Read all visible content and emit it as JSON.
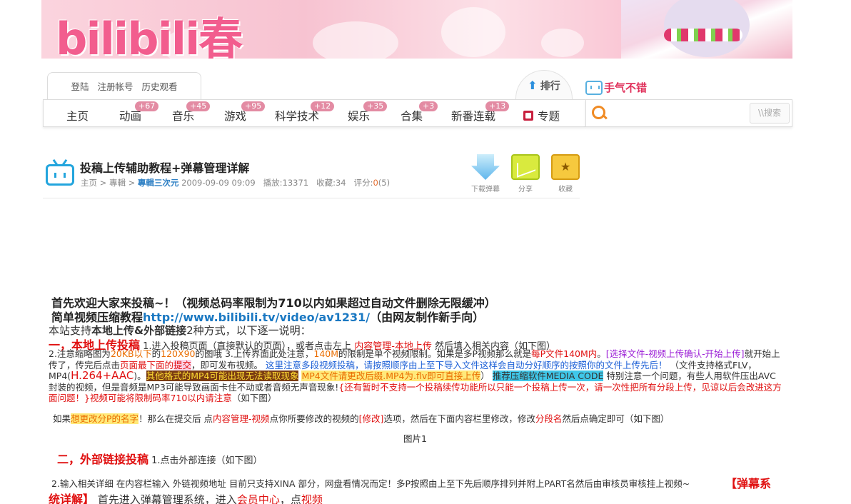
{
  "banner": {
    "logo": "bilibili春"
  },
  "topbar": {
    "login": "登陆",
    "register": "注册帐号",
    "history": "历史观看",
    "rank": "排行",
    "luck": "手气不错"
  },
  "nav": {
    "items": [
      {
        "label": "主页",
        "badge": ""
      },
      {
        "label": "动画",
        "badge": "+67"
      },
      {
        "label": "音乐",
        "badge": "+45"
      },
      {
        "label": "游戏",
        "badge": "+95"
      },
      {
        "label": "科学技术",
        "badge": "+12"
      },
      {
        "label": "娱乐",
        "badge": "+35"
      },
      {
        "label": "合集",
        "badge": "+3"
      },
      {
        "label": "新番连载",
        "badge": "+13"
      },
      {
        "label": "专题",
        "badge": ""
      }
    ]
  },
  "search": {
    "placeholder": "",
    "button": "\\\\搜索"
  },
  "video": {
    "title": "投稿上传辅助教程+弹幕管理详解",
    "crumb_home": "主页",
    "crumb_sep": ">",
    "crumb_section": "專輯",
    "crumb_category": "專輯三次元",
    "datetime": "2009-09-09 09:09",
    "plays_label": "播放:",
    "plays": "13371",
    "favs_label": "收藏:",
    "favs": "34",
    "score_label": "评分:",
    "score": "0",
    "score_count": "(5)",
    "actions": {
      "download": "下载弹幕",
      "share": "分享",
      "fav": "收藏"
    }
  },
  "content": {
    "l1": "首先欢迎大家来投稿~！（视频总码率限制为710以内如果超过自动文件删除无限缓冲）",
    "l2a": "简单视频压缩教程",
    "l2b": "http://www.bilibili.tv/video/av1231/",
    "l2c": "（由网友制作新手向）",
    "l3a": "本站支持",
    "l3b": "本地上传&外部链接",
    "l3c": "2种方式，以下逐一说明：",
    "s1_title": "一，本地上传投稿",
    "s1_a": "1.进入投稿页面（直接默认的页面），或者点击左上",
    "s1_b": "内容管理-本地上传",
    "s1_c": "然后填入相关内容（如下图）",
    "p2_a": "2.注意缩略图为",
    "p2_b": "20KB以下",
    "p2_c": "的",
    "p2_d": "120X90",
    "p2_e": "的图哦 3.上传界面此处注意，",
    "p2_f": "140M",
    "p2_g": "的限制是单个视频限制。如果是多P视频那么就是",
    "p2_h": "每P文件140M内",
    "p2_i": "。",
    "p2_j": "[选择文件-视频上传确认-开始上传]",
    "p2_k": "就开始上传了，传完后点击",
    "p2_l": "页面最下面的",
    "p2_m": "提交",
    "p2_n": "，即可发布视频。",
    "p2_o": "这里注意多段视频投稿，请按照顺序由上至下导入文件这样会自动分好顺序的按照你的文件上传先后！",
    "p2_p": "（文件支持格式FLV，MP4(",
    "p2_q": "H.264+AAC",
    "p2_r": ")。",
    "p2_s": "其他格式的MP4可能出现无法读取现象",
    "p2_t": "MP4文件请更改后缀.MP4为.flv即可直接上传",
    "p2_u": "）",
    "p2_v": "推荐压缩软件MEDIA CODE",
    "p2_w": "特别注意一个问题，有些人用软件压出AVC封装的视频，但是音频是MP3可能导致画面卡住不动或者音频无声音现象!",
    "p2_x": "{还有暂时不支持一个投稿续传功能所以只能一个投稿上传一次，请一次性把所有分段上传，见谅以后会改进这方面问题！}",
    "p2_y": "视频可能将限制码率710以内请注意",
    "p2_z": "（如下图）",
    "p3_a": "如果",
    "p3_b": "想更改分P的名字",
    "p3_c": "！那么在提交后 点",
    "p3_d": "内容管理-视频",
    "p3_e": "点你所要修改的视频的",
    "p3_f": "[修改]",
    "p3_g": "选项，然后在下面内容栏里修改，修改",
    "p3_h": "分段名",
    "p3_i": "然后点确定即可（如下图）",
    "pic1": "图片1",
    "s2_title": "二，外部链接投稿",
    "s2_a": "1.点击外部连接（如下图）",
    "p4": "2.输入相关详细 在内容栏输入 外链视频地址 目前只支持XINA 部分，网盘看情况而定！多P按照由上至下先后顺序排列并附上PART名然后由审核员审核挂上视频~",
    "s3_title_a": "【弹幕系",
    "s3_title_b": "统详解】",
    "s3_a": "首先进入弹幕管理系统，进入",
    "s3_b": "会员中心",
    "s3_c": "，点",
    "s3_d": "视频"
  }
}
